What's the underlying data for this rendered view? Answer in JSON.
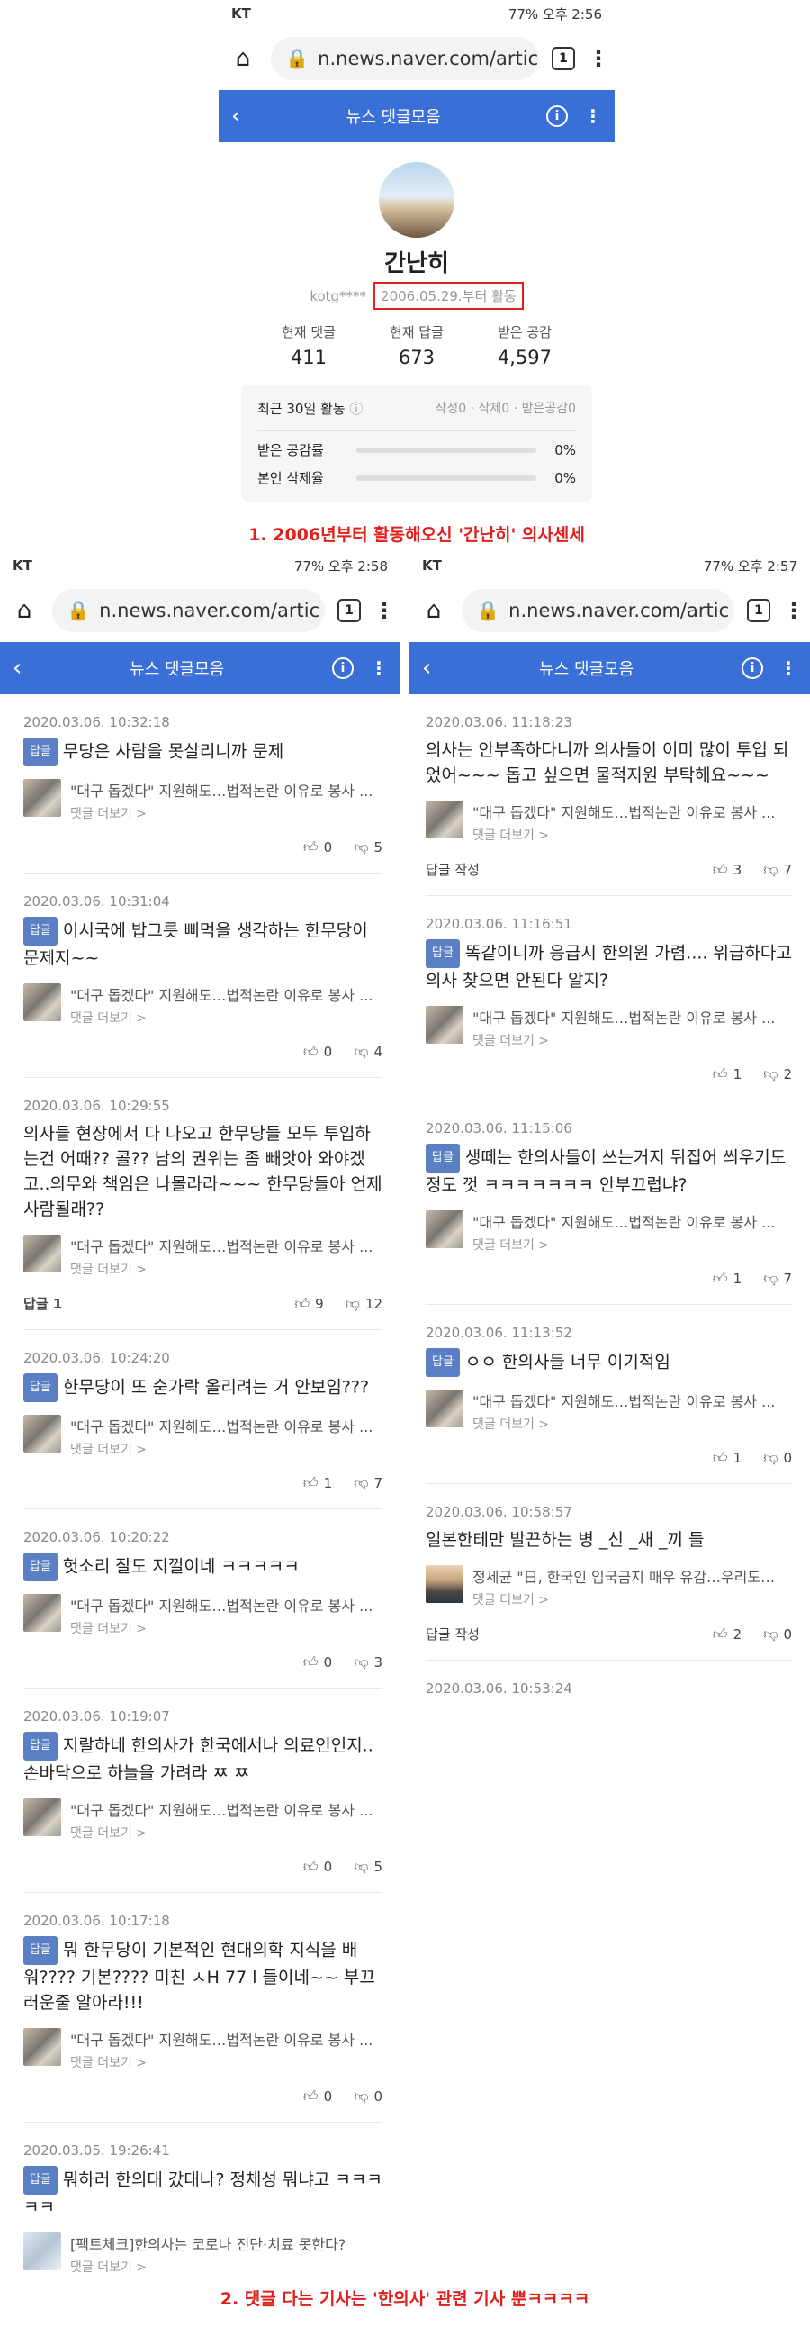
{
  "top": {
    "status": {
      "carrier": "KT",
      "right": "77% 오후 2:56"
    },
    "url": "n.news.naver.com/artic",
    "tabs_count": "1",
    "header_title": "뉴스 댓글모음",
    "user_name": "간난히",
    "user_id": "kotg****",
    "since": "2006.05.29.부터 활동",
    "stats": [
      {
        "label": "현재 댓글",
        "value": "411"
      },
      {
        "label": "현재 답글",
        "value": "673"
      },
      {
        "label": "받은 공감",
        "value": "4,597"
      }
    ],
    "recent_label": "최근 30일 활동",
    "recent_counts": "작성0 · 삭제0 · 받은공감0",
    "rates": [
      {
        "label": "받은 공감률",
        "value": "0%"
      },
      {
        "label": "본인 삭제율",
        "value": "0%"
      }
    ],
    "caption": "1. 2006년부터 활동해오신 '간난히' 의사센세"
  },
  "left": {
    "status": {
      "carrier": "KT",
      "right": "77% 오후 2:58"
    },
    "url": "n.news.naver.com/artic",
    "tabs_count": "1",
    "header_title": "뉴스 댓글모음",
    "comments": [
      {
        "date": "2020.03.06. 10:32:18",
        "tag": "답글",
        "text": "무당은 사람을 못살리니까 문제",
        "article": "\"대구 돕겠다\" 지원해도…법적논란 이유로 봉사 ...",
        "more": "댓글 더보기 >",
        "reply": "",
        "up": "0",
        "down": "5",
        "thumb": "crowd"
      },
      {
        "date": "2020.03.06. 10:31:04",
        "tag": "답글",
        "text": "이시국에 밥그릇 삐먹을 생각하는 한무당이 문제지~~",
        "article": "\"대구 돕겠다\" 지원해도…법적논란 이유로 봉사 ...",
        "more": "댓글 더보기 >",
        "reply": "",
        "up": "0",
        "down": "4",
        "thumb": "crowd"
      },
      {
        "date": "2020.03.06. 10:29:55",
        "tag": "",
        "text": "의사들 현장에서 다 나오고 한무당들 모두 투입하는건 어때?? 콜?? 남의 권위는 좀 빼앗아 와야겠고..의무와 책임은 나몰라라~~~ 한무당들아 언제 사람될래??",
        "article": "\"대구 돕겠다\" 지원해도…법적논란 이유로 봉사 ...",
        "more": "댓글 더보기 >",
        "reply": "답글 1",
        "up": "9",
        "down": "12",
        "thumb": "crowd"
      },
      {
        "date": "2020.03.06. 10:24:20",
        "tag": "답글",
        "text": "한무당이 또 숟가락 올리려는 거 안보임???",
        "article": "\"대구 돕겠다\" 지원해도…법적논란 이유로 봉사 ...",
        "more": "댓글 더보기 >",
        "reply": "",
        "up": "1",
        "down": "7",
        "thumb": "crowd"
      },
      {
        "date": "2020.03.06. 10:20:22",
        "tag": "답글",
        "text": "헛소리 잘도 지껄이네 ㅋㅋㅋㅋㅋ",
        "article": "\"대구 돕겠다\" 지원해도…법적논란 이유로 봉사 ...",
        "more": "댓글 더보기 >",
        "reply": "",
        "up": "0",
        "down": "3",
        "thumb": "crowd"
      },
      {
        "date": "2020.03.06. 10:19:07",
        "tag": "답글",
        "text": "지랄하네 한의사가 한국에서나 의료인인지.. 손바닥으로 하늘을 가려라 ㅉ ㅉ",
        "article": "\"대구 돕겠다\" 지원해도…법적논란 이유로 봉사 ...",
        "more": "댓글 더보기 >",
        "reply": "",
        "up": "0",
        "down": "5",
        "thumb": "crowd"
      },
      {
        "date": "2020.03.06. 10:17:18",
        "tag": "답글",
        "text": "뭐 한무당이 기본적인 현대의학 지식을 배워???? 기본???? 미친 ㅅH 77 l 들이네~~ 부끄러운줄 알아라!!!",
        "article": "\"대구 돕겠다\" 지원해도…법적논란 이유로 봉사 ...",
        "more": "댓글 더보기 >",
        "reply": "",
        "up": "0",
        "down": "0",
        "thumb": "crowd"
      },
      {
        "date": "2020.03.05. 19:26:41",
        "tag": "답글",
        "text": "뭐하러 한의대 갔대나? 정체성 뭐냐고 ㅋㅋㅋㅋㅋ",
        "article": "[팩트체크]한의사는 코로나 진단·치료 못한다?",
        "more": "댓글 더보기 >",
        "reply": "",
        "up": "",
        "down": "",
        "thumb": "fc"
      }
    ]
  },
  "right": {
    "status": {
      "carrier": "KT",
      "right": "77% 오후 2:57"
    },
    "url": "n.news.naver.com/artic",
    "tabs_count": "1",
    "header_title": "뉴스 댓글모음",
    "comments": [
      {
        "date": "2020.03.06. 11:18:23",
        "tag": "",
        "text": "의사는 안부족하다니까 의사들이 이미 많이 투입 되었어~~~ 돕고 싶으면 물적지원 부탁해요~~~",
        "article": "\"대구 돕겠다\" 지원해도…법적논란 이유로 봉사 ...",
        "more": "댓글 더보기 >",
        "reply": "답글 작성",
        "up": "3",
        "down": "7",
        "thumb": "crowd"
      },
      {
        "date": "2020.03.06. 11:16:51",
        "tag": "답글",
        "text": "똑같이니까 응급시 한의원 가렴.... 위급하다고 의사 찾으면 안된다 알지?",
        "article": "\"대구 돕겠다\" 지원해도…법적논란 이유로 봉사 ...",
        "more": "댓글 더보기 >",
        "reply": "",
        "up": "1",
        "down": "2",
        "thumb": "crowd"
      },
      {
        "date": "2020.03.06. 11:15:06",
        "tag": "답글",
        "text": "생떼는 한의사들이 쓰는거지 뒤집어 씌우기도 정도 껏 ㅋㅋㅋㅋㅋㅋㅋ 안부끄럽냐?",
        "article": "\"대구 돕겠다\" 지원해도…법적논란 이유로 봉사 ...",
        "more": "댓글 더보기 >",
        "reply": "",
        "up": "1",
        "down": "7",
        "thumb": "crowd"
      },
      {
        "date": "2020.03.06. 11:13:52",
        "tag": "답글",
        "text": "ㅇㅇ 한의사들 너무 이기적임",
        "article": "\"대구 돕겠다\" 지원해도…법적논란 이유로 봉사 ...",
        "more": "댓글 더보기 >",
        "reply": "",
        "up": "1",
        "down": "0",
        "thumb": "crowd"
      },
      {
        "date": "2020.03.06. 10:58:57",
        "tag": "",
        "text": "일본한테만 발끈하는 병 _신 _새 _끼 들",
        "article": "정세균 \"日, 한국인 입국금지 매우 유감…우리도 ...",
        "more": "댓글 더보기 >",
        "reply": "답글 작성",
        "up": "2",
        "down": "0",
        "thumb": "face"
      },
      {
        "date": "2020.03.06. 10:53:24",
        "tag": "",
        "text": "",
        "article": "",
        "more": "",
        "reply": "",
        "up": "",
        "down": "",
        "thumb": ""
      }
    ]
  },
  "caption2": "2. 댓글 다는 기사는 '한의사' 관련 기사 뿐ㅋㅋㅋㅋ",
  "colors": {
    "header_blue": "#3a6fd8",
    "caption_red": "#e0201c",
    "tag_blue": "#5b7fc4"
  }
}
